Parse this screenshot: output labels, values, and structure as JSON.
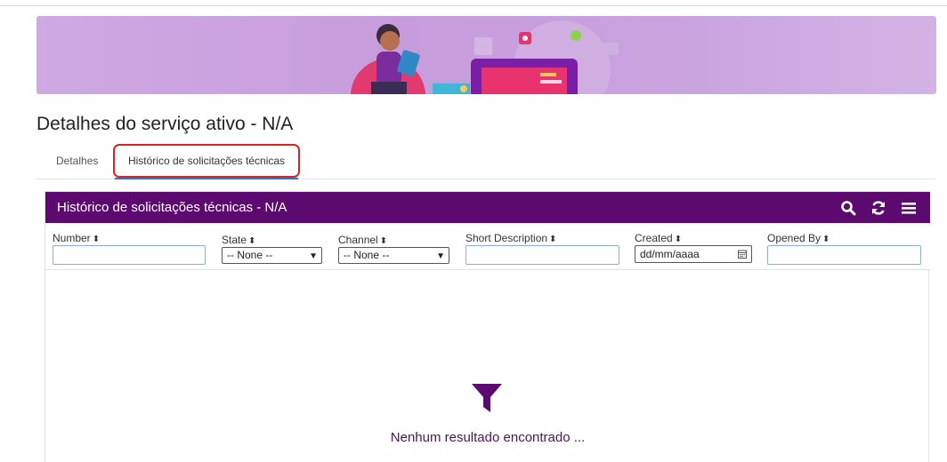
{
  "page": {
    "title": "Detalhes do serviço ativo - N/A"
  },
  "tabs": [
    {
      "label": "Detalhes"
    },
    {
      "label": "Histórico de solicitações técnicas"
    }
  ],
  "panel": {
    "title": "Histórico de solicitações técnicas - N/A",
    "icons": [
      "search-icon",
      "refresh-icon",
      "menu-icon"
    ],
    "columns": [
      {
        "label": "Number",
        "sort": "⬍",
        "filter_type": "text",
        "value": ""
      },
      {
        "label": "State",
        "sort": "⬍",
        "filter_type": "select",
        "value": "-- None --"
      },
      {
        "label": "Channel",
        "sort": "⬍",
        "filter_type": "select",
        "value": "-- None --"
      },
      {
        "label": "Short Description",
        "sort": "⬍",
        "filter_type": "text",
        "value": ""
      },
      {
        "label": "Created",
        "sort": "⬍",
        "filter_type": "date",
        "value": "dd/mm/aaaa"
      },
      {
        "label": "Opened By",
        "sort": "⬍",
        "filter_type": "text",
        "value": ""
      }
    ],
    "empty_message": "Nenhum resultado encontrado ..."
  },
  "colors": {
    "header_bg": "#5c0a6f",
    "highlight": "#e02020",
    "empty_text": "#4b1557"
  }
}
